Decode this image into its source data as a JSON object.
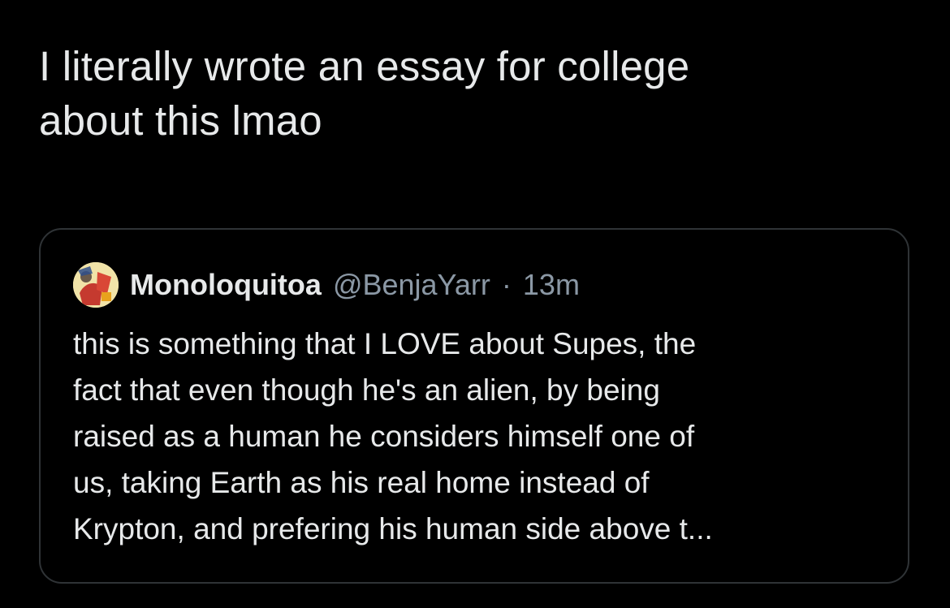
{
  "tweet": {
    "text": "I literally wrote an essay for college\nabout this lmao"
  },
  "quote": {
    "avatar_icon": "user-avatar-icon",
    "display_name": "Monoloquitoa",
    "handle": "@BenjaYarr",
    "separator": "·",
    "time": "13m",
    "text": "this is something that I LOVE about Supes, the\nfact that even though he's an alien, by being\nraised as a human he considers himself one of\nus, taking Earth as his real home instead of\nKrypton, and prefering his human side above t..."
  },
  "colors": {
    "background": "#000000",
    "primary_text": "#e7e9ea",
    "secondary_text": "#8b98a5",
    "border": "#2f3336"
  }
}
